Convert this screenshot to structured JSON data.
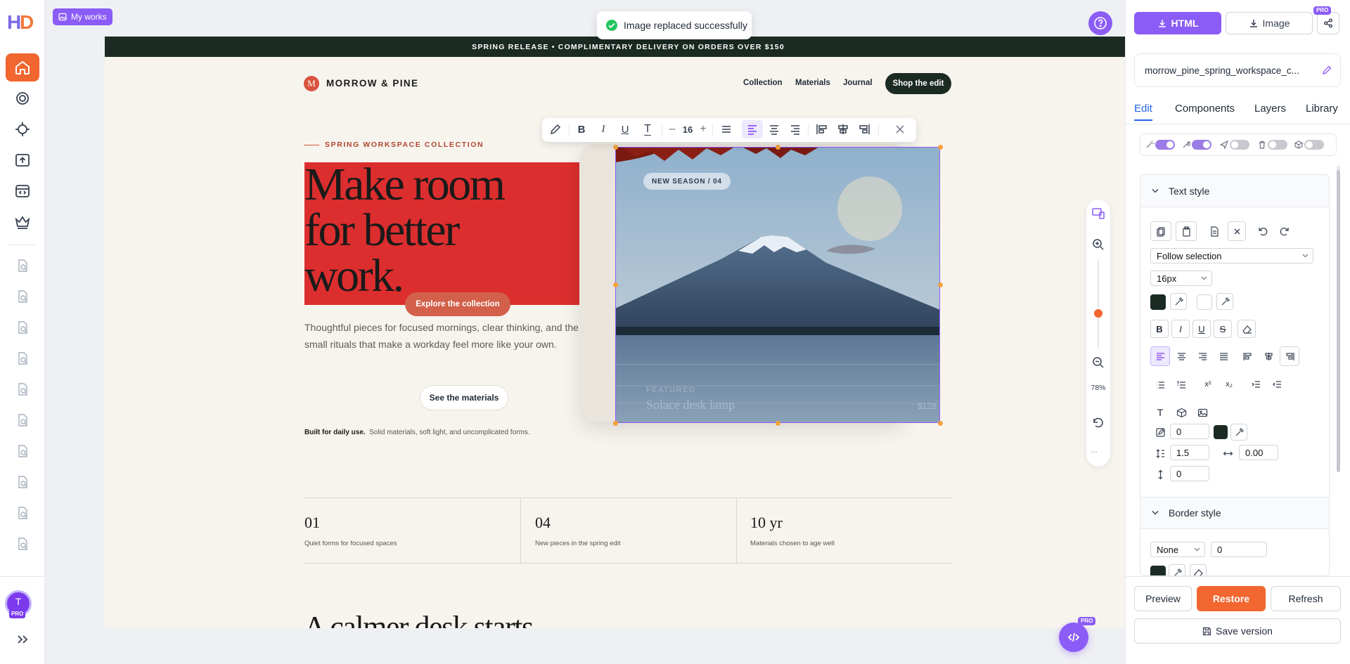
{
  "toast": {
    "message": "Image replaced successfully"
  },
  "topbar": {
    "my_works_label": "My works"
  },
  "page": {
    "announcement": "SPRING RELEASE • COMPLIMENTARY DELIVERY ON ORDERS OVER $150",
    "brand": {
      "logo_letter": "M",
      "name": "MORROW & PINE"
    },
    "nav": [
      "Collection",
      "Materials",
      "Journal"
    ],
    "nav_cta": "Shop the edit",
    "hero": {
      "eyebrow": "SPRING WORKSPACE COLLECTION",
      "headline_lines": [
        "Make room",
        "for better",
        "work."
      ],
      "primary_cta": "Explore the collection",
      "body": "Thoughtful pieces for focused mornings, clear thinking, and the small rituals that make a workday feel more like your own.",
      "secondary_cta": "See the materials",
      "note_bold": "Built for daily use.",
      "note": "Solid materials, soft light, and uncomplicated forms.",
      "image_badge": "NEW SEASON / 04",
      "image_caption_small": "FEATURED",
      "image_caption_title": "Solace desk lamp",
      "image_caption_price": "$128"
    },
    "stats": [
      {
        "value": "01",
        "label": "Quiet forms for focused spaces"
      },
      {
        "value": "04",
        "label": "New pieces in the spring edit"
      },
      {
        "value": "10 yr",
        "label": "Materials chosen to age well"
      }
    ],
    "next_heading": "A calmer desk starts"
  },
  "text_toolbar": {
    "font_size": "16"
  },
  "zoom": {
    "level": "78%",
    "slider_fraction": 0.6
  },
  "right_panel": {
    "export_html": "HTML",
    "export_image": "Image",
    "pro_badge": "PRO",
    "filename": "morrow_pine_spring_workspace_c...",
    "tabs": [
      "Edit",
      "Components",
      "Layers",
      "Library"
    ],
    "active_tab": "Edit",
    "text_style": {
      "title": "Text style",
      "selection_mode": "Follow selection",
      "font_size": "16px",
      "border_width": "0",
      "line_height": "1.5",
      "letter_spacing": "0.00",
      "paragraph_spacing": "0"
    },
    "border_style": {
      "title": "Border style",
      "style": "None",
      "width": "0"
    },
    "buttons": {
      "preview": "Preview",
      "restore": "Restore",
      "refresh": "Refresh",
      "save_version": "Save version"
    }
  },
  "user": {
    "initial": "T",
    "badge": "PRO"
  },
  "colors": {
    "accent_purple": "#8b5cf6",
    "accent_orange": "#f2662f",
    "hero_red": "#dc2e2e",
    "dark": "#1b2a22"
  }
}
